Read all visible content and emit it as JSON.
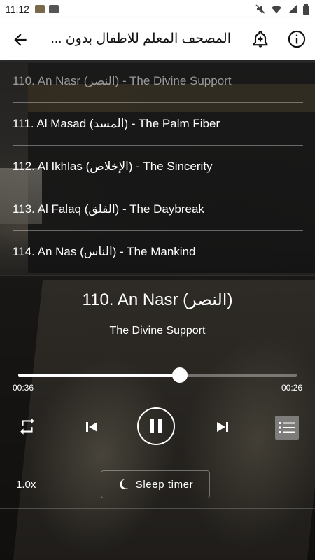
{
  "status_bar": {
    "time": "11:12",
    "left_icons": [
      "app-notification-icon",
      "photo-icon"
    ],
    "right_icons": [
      "mute-icon",
      "wifi-icon",
      "signal-icon",
      "battery-icon"
    ]
  },
  "app_bar": {
    "title": "المصحف المعلم للاطفال بدون ...",
    "icons": [
      "back-arrow-icon",
      "add-alarm-icon",
      "info-icon"
    ]
  },
  "tracks": [
    {
      "label": "110. An Nasr (النصر) - The Divine Support",
      "current": true
    },
    {
      "label": "111. Al Masad (المسد) - The Palm Fiber",
      "current": false
    },
    {
      "label": "112. Al Ikhlas (الإخلاص) - The Sincerity",
      "current": false
    },
    {
      "label": "113. Al Falaq (الفلق) - The Daybreak",
      "current": false
    },
    {
      "label": "114. An Nas (الناس) - The Mankind",
      "current": false
    }
  ],
  "player": {
    "title": "110. An Nasr (النصر)",
    "subtitle": "The Divine Support",
    "elapsed": "00:36",
    "remaining": "00:26",
    "progress": 0.58,
    "speed": "1.0x",
    "sleep_timer_label": "Sleep timer",
    "state": "playing"
  },
  "colors": {
    "accent": "#ffffff",
    "app_bar_bg": "#ffffff",
    "list_button_bg": "#969696"
  }
}
